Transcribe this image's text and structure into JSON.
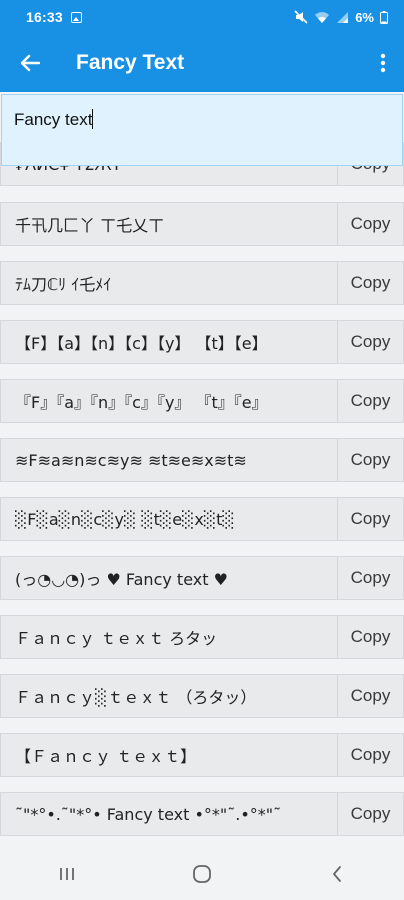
{
  "status_bar": {
    "time": "16:33",
    "battery": "6%"
  },
  "app_bar": {
    "title": "Fancy Text"
  },
  "input": {
    "value": "Fancy text"
  },
  "rows": [
    {
      "text": "₣ΛИƇ¥ ƬΣЖƬ",
      "copy": "Copy"
    },
    {
      "text": "千卂几匚丫 ㄒ乇乂ㄒ",
      "copy": "Copy"
    },
    {
      "text": "ﾃﾑ刀ℂﾘ ｲ乇ﾒｲ",
      "copy": "Copy"
    },
    {
      "text": "【F】【a】【n】【c】【y】 【t】【e】",
      "copy": "Copy"
    },
    {
      "text": "『F』『a』『n』『c』『y』 『t』『e』",
      "copy": "Copy"
    },
    {
      "text": "≋F≋a≋n≋c≋y≋ ≋t≋e≋x≋t≋",
      "copy": "Copy"
    },
    {
      "text": "░F░a░n░c░y░ ░t░e░x░t░",
      "copy": "Copy"
    },
    {
      "text": "(っ◔◡◔)っ ♥ Fancy text ♥",
      "copy": "Copy"
    },
    {
      "text": "Ｆａｎｃｙ ｔｅｘｔ ろタッ",
      "copy": "Copy"
    },
    {
      "text": "Ｆａｎｃｙ░ｔｅｘｔ （ろタッ）",
      "copy": "Copy"
    },
    {
      "text": "【Ｆａｎｃｙ ｔｅｘｔ】",
      "copy": "Copy"
    },
    {
      "text": "˜\"*°•.˜\"*°• Fancy text •°*\"˜.•°*\"˜",
      "copy": "Copy"
    }
  ]
}
